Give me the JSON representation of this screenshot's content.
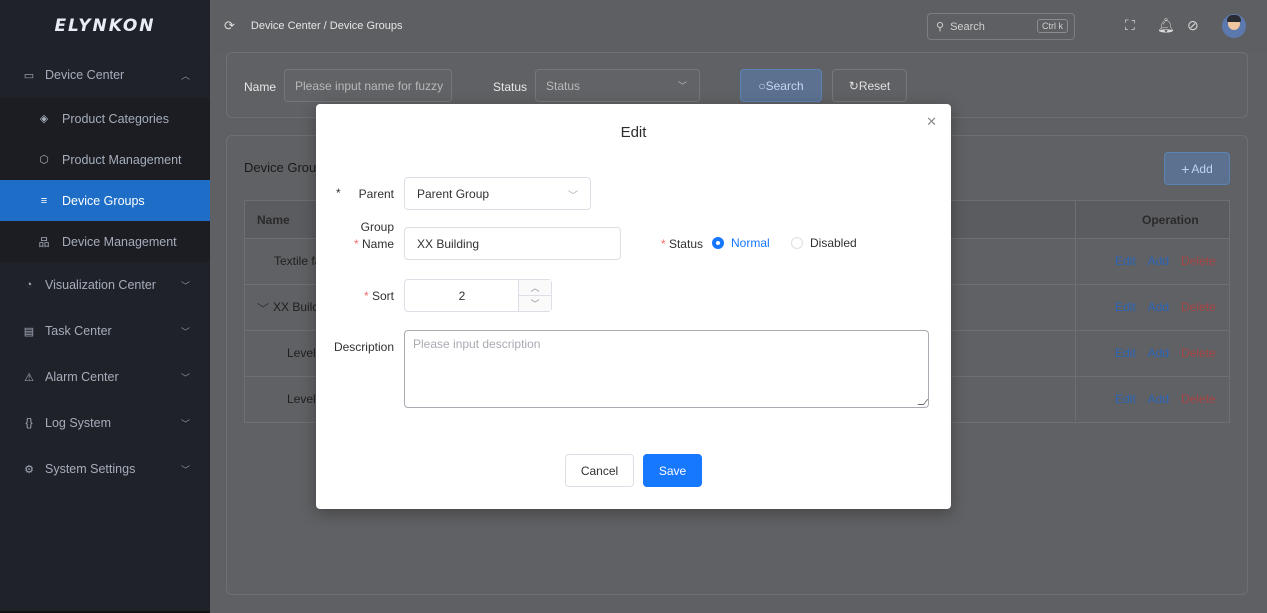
{
  "app": {
    "logo": "ELYNKON"
  },
  "sidebar": {
    "items": [
      {
        "label": "Device Center",
        "icon": "monitor-icon",
        "expanded": true
      },
      {
        "label": "Product Categories",
        "icon": "layers-icon"
      },
      {
        "label": "Product Management",
        "icon": "cube-icon"
      },
      {
        "label": "Device Groups",
        "icon": "list-icon",
        "active": true
      },
      {
        "label": "Device Management",
        "icon": "hierarchy-icon"
      },
      {
        "label": "Visualization Center",
        "icon": "chart-icon"
      },
      {
        "label": "Task Center",
        "icon": "calendar-icon"
      },
      {
        "label": "Alarm Center",
        "icon": "alarm-icon"
      },
      {
        "label": "Log System",
        "icon": "log-icon"
      },
      {
        "label": "System Settings",
        "icon": "gear-icon"
      }
    ]
  },
  "topbar": {
    "breadcrumb": "Device Center / Device Groups",
    "search_placeholder": "Search",
    "shortcut": "Ctrl k"
  },
  "filter": {
    "name_label": "Name",
    "name_placeholder": "Please input name for fuzzy",
    "status_label": "Status",
    "status_placeholder": "Status",
    "search_button": "Search",
    "reset_button": "Reset"
  },
  "table": {
    "title": "Device Grou",
    "add_button": "Add",
    "columns": {
      "name": "Name",
      "operation": "Operation"
    },
    "rows": [
      {
        "name": "Textile fa"
      },
      {
        "name": "XX Build"
      },
      {
        "name": "Level"
      },
      {
        "name": "Level"
      }
    ],
    "ops": {
      "edit": "Edit",
      "add": "Add",
      "delete": "Delete"
    }
  },
  "modal": {
    "title": "Edit",
    "parent_label": "Parent",
    "parent_value": "Parent Group",
    "group_name_label_1": "Group",
    "group_name_label_2": "Name",
    "group_name_value": "XX Building",
    "status_label": "Status",
    "status_options": [
      "Normal",
      "Disabled"
    ],
    "status_selected": "Normal",
    "sort_label": "Sort",
    "sort_value": "2",
    "description_label": "Description",
    "description_placeholder": "Please input description",
    "cancel_button": "Cancel",
    "save_button": "Save"
  },
  "colors": {
    "primary": "#1677ff",
    "danger": "#f56c6c",
    "sidebar_bg": "#1f2229",
    "active_menu": "#1e6ec8"
  }
}
